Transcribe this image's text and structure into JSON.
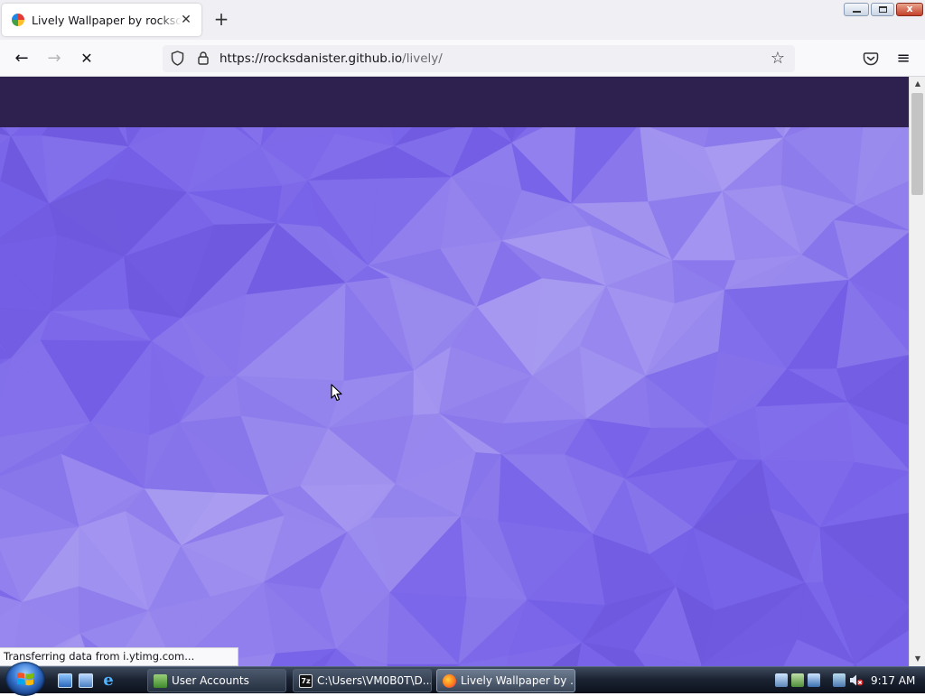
{
  "browser": {
    "tab": {
      "title": "Lively Wallpaper by rocksdanister",
      "close_glyph": "✕"
    },
    "new_tab_glyph": "+",
    "window_buttons": {
      "minimize": "",
      "maximize": "",
      "close": "x"
    },
    "nav": {
      "back_glyph": "←",
      "forward_glyph": "→",
      "stop_glyph": "✕"
    },
    "url": {
      "host": "https://rocksdanister.github.io",
      "path": "/lively/"
    },
    "bookmark_glyph": "☆",
    "menu_glyph": "≡"
  },
  "page": {
    "header_color": "#2f214f",
    "hero_color": "#7560e8"
  },
  "status_text": "Transferring data from i.ytimg.com...",
  "taskbar": {
    "tasks": [
      {
        "label": "User Accounts"
      },
      {
        "label": "C:\\Users\\VM0B0T\\D...",
        "icon_text": "7z"
      },
      {
        "label": "Lively Wallpaper by ..."
      }
    ],
    "clock": "9:17 AM"
  }
}
